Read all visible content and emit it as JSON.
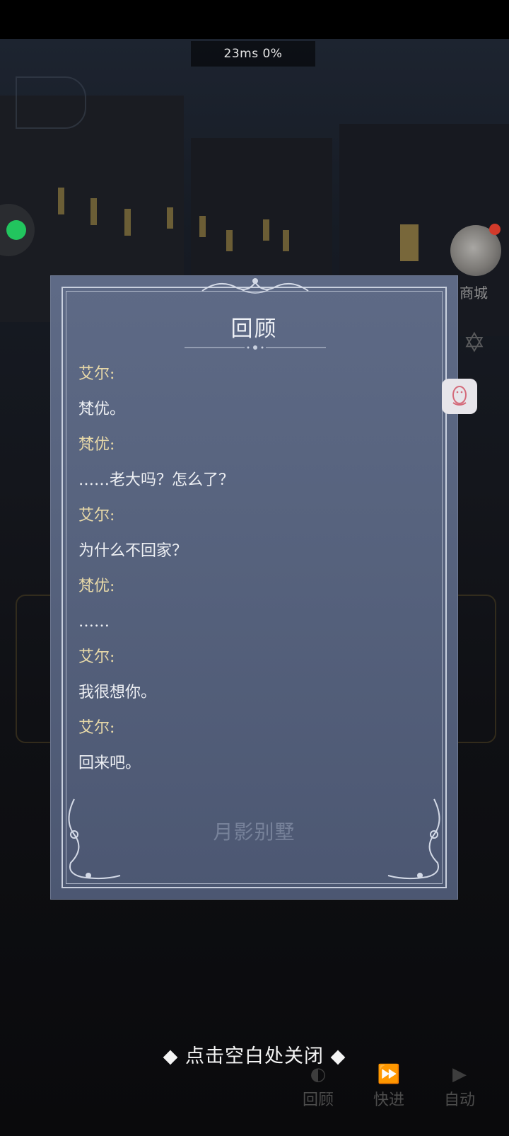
{
  "overlay": {
    "ping": "23ms  0%"
  },
  "side": {
    "shop_label": "商城"
  },
  "panel": {
    "title": "回顾",
    "entries": [
      {
        "type": "speaker",
        "text": "艾尔:"
      },
      {
        "type": "text",
        "text": "梵优。"
      },
      {
        "type": "speaker",
        "text": "梵优:"
      },
      {
        "type": "text",
        "text": "……老大吗？怎么了？"
      },
      {
        "type": "speaker",
        "text": "艾尔:"
      },
      {
        "type": "text",
        "text": "为什么不回家？"
      },
      {
        "type": "speaker",
        "text": "梵优:"
      },
      {
        "type": "text",
        "text": "……"
      },
      {
        "type": "speaker",
        "text": "艾尔:"
      },
      {
        "type": "text",
        "text": "我很想你。"
      },
      {
        "type": "speaker",
        "text": "艾尔:"
      },
      {
        "type": "text",
        "text": "回来吧。"
      }
    ],
    "logo_text": "月影别墅"
  },
  "close_hint": "◆ 点击空白处关闭 ◆",
  "bottom_bar": {
    "review_label": "回顾",
    "fastforward_label": "快进",
    "auto_label": "自动"
  },
  "colors": {
    "speaker": "#e8d9a8",
    "text": "#eef0f4",
    "panel": "#57637e",
    "status_green": "#22c55e"
  }
}
